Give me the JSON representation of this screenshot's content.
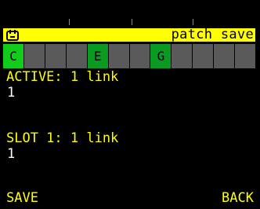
{
  "header": {
    "title": "patch save",
    "icon": "pedal-icon",
    "accent": "#ffff00"
  },
  "keys": [
    {
      "label": "C",
      "state": "active"
    },
    {
      "label": "",
      "state": "off"
    },
    {
      "label": "",
      "state": "off"
    },
    {
      "label": "",
      "state": "off"
    },
    {
      "label": "E",
      "state": "on"
    },
    {
      "label": "",
      "state": "off"
    },
    {
      "label": "",
      "state": "off"
    },
    {
      "label": "G",
      "state": "on"
    },
    {
      "label": "",
      "state": "off"
    },
    {
      "label": "",
      "state": "off"
    },
    {
      "label": "",
      "state": "off"
    },
    {
      "label": "",
      "state": "off"
    }
  ],
  "active": {
    "heading": "ACTIVE: 1 link",
    "value": "1"
  },
  "slot": {
    "heading": "SLOT 1: 1 link",
    "value": "1"
  },
  "softkeys": {
    "left": "SAVE",
    "right": "BACK"
  }
}
